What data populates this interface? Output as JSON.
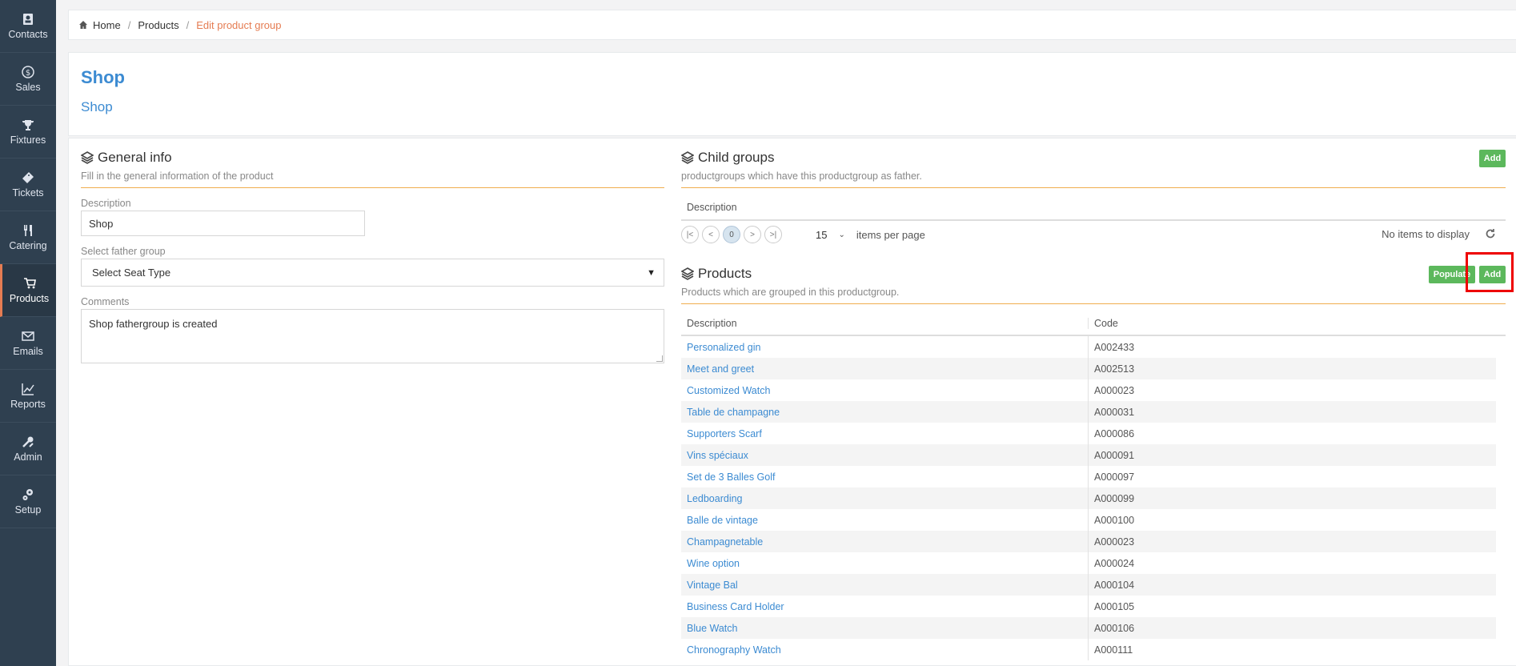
{
  "sidebar": {
    "items": [
      {
        "label": "Contacts",
        "icon": "contacts-icon"
      },
      {
        "label": "Sales",
        "icon": "dollar-icon"
      },
      {
        "label": "Fixtures",
        "icon": "trophy-icon"
      },
      {
        "label": "Tickets",
        "icon": "ticket-icon"
      },
      {
        "label": "Catering",
        "icon": "cutlery-icon"
      },
      {
        "label": "Products",
        "icon": "cart-icon"
      },
      {
        "label": "Emails",
        "icon": "envelope-icon"
      },
      {
        "label": "Reports",
        "icon": "chart-line-icon"
      },
      {
        "label": "Admin",
        "icon": "tools-icon"
      },
      {
        "label": "Setup",
        "icon": "cogs-icon"
      }
    ],
    "active": "Products"
  },
  "breadcrumb": [
    "Home",
    "Products",
    "Edit product group"
  ],
  "header": {
    "title": "Shop",
    "subtitle": "Shop"
  },
  "general": {
    "title": "General info",
    "subtitle": "Fill in the general information of the product",
    "description_label": "Description",
    "description_value": "Shop",
    "father_label": "Select father group",
    "father_value": "Select Seat Type",
    "comments_label": "Comments",
    "comments_value": "Shop fathergroup is created"
  },
  "child_groups": {
    "title": "Child groups",
    "subtitle": "productgroups which have this productgroup as father.",
    "add_label": "Add",
    "column": "Description",
    "pager": {
      "page": "0",
      "page_size": "15",
      "items_per_page": "items per page",
      "empty": "No items to display"
    }
  },
  "products": {
    "title": "Products",
    "subtitle": "Products which are grouped in this productgroup.",
    "populate_label": "Populate",
    "add_label": "Add",
    "columns": [
      "Description",
      "Code"
    ],
    "rows": [
      {
        "desc": "Personalized gin",
        "code": "A002433"
      },
      {
        "desc": "Meet and greet",
        "code": "A002513"
      },
      {
        "desc": "Customized Watch",
        "code": "A000023"
      },
      {
        "desc": "Table de champagne",
        "code": "A000031"
      },
      {
        "desc": "Supporters Scarf",
        "code": "A000086"
      },
      {
        "desc": "Vins spéciaux",
        "code": "A000091"
      },
      {
        "desc": "Set de 3 Balles Golf",
        "code": "A000097"
      },
      {
        "desc": "Ledboarding",
        "code": "A000099"
      },
      {
        "desc": "Balle de vintage",
        "code": "A000100"
      },
      {
        "desc": "Champagnetable",
        "code": "A000023"
      },
      {
        "desc": "Wine option",
        "code": "A000024"
      },
      {
        "desc": "Vintage Bal",
        "code": "A000104"
      },
      {
        "desc": "Business Card Holder",
        "code": "A000105"
      },
      {
        "desc": "Blue Watch",
        "code": "A000106"
      },
      {
        "desc": "Chronography Watch",
        "code": "A000111"
      }
    ]
  },
  "colors": {
    "sidebar": "#2f4050",
    "accent": "#e57c52",
    "link": "#3c8bd2",
    "button": "#5cb85c",
    "highlight": "#ee0000"
  }
}
